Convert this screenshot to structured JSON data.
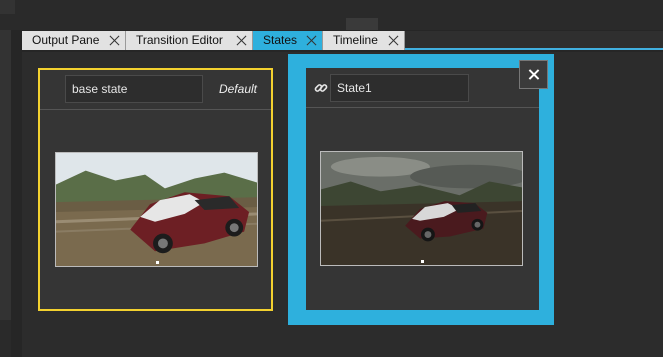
{
  "tabs": [
    {
      "label": "Output Pane",
      "active": false
    },
    {
      "label": "Transition Editor",
      "active": false
    },
    {
      "label": "States",
      "active": true
    },
    {
      "label": "Timeline",
      "active": false
    }
  ],
  "states": {
    "base": {
      "name": "base state",
      "tag": "Default",
      "thumbnail_icon": "car-preview-image"
    },
    "state1": {
      "name": "State1",
      "thumbnail_icon": "car-preview-image",
      "link_icon": "link-icon"
    }
  },
  "colors": {
    "accent": "#2eb0dd",
    "default_border": "#f3d12f",
    "panel": "#2c2c2c"
  },
  "icons": {
    "close": "close-icon",
    "tab_close": "close-icon"
  }
}
